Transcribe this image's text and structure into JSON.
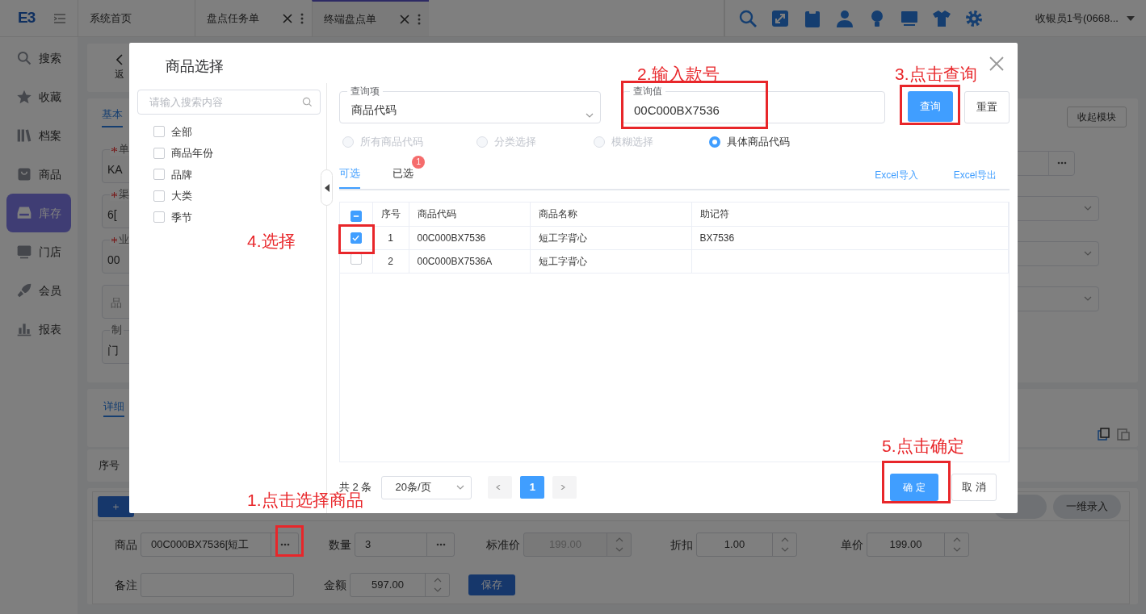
{
  "header": {
    "logo": "E3",
    "tabs": [
      {
        "label": "系统首页",
        "selected": false,
        "closable": false
      },
      {
        "label": "盘点任务单",
        "selected": false,
        "closable": true
      },
      {
        "label": "终端盘点单",
        "selected": true,
        "closable": true
      }
    ],
    "user": "收银员1号(0668..."
  },
  "sidebar": {
    "items": [
      {
        "label": "搜索",
        "selected": false
      },
      {
        "label": "收藏",
        "selected": false
      },
      {
        "label": "档案",
        "selected": false
      },
      {
        "label": "商品",
        "selected": false
      },
      {
        "label": "库存",
        "selected": true
      },
      {
        "label": "门店",
        "selected": false
      },
      {
        "label": "会员",
        "selected": false
      },
      {
        "label": "报表",
        "selected": false
      }
    ]
  },
  "page": {
    "back": "返",
    "base_tab": "基本",
    "collapse_button": "收起模块",
    "fields_left": [
      {
        "label": "单",
        "required": true,
        "value": "KA"
      },
      {
        "label": "渠",
        "required": true,
        "value": "6["
      },
      {
        "label": "业",
        "required": true,
        "value": "00"
      },
      {
        "placeholder": "品"
      },
      {
        "label": "制",
        "required": false,
        "value": "门"
      }
    ],
    "fields_right": [
      {
        "kind": "lookup"
      },
      {
        "kind": "select"
      },
      {
        "kind": "select"
      },
      {
        "kind": "select"
      }
    ],
    "detail_tab": "详细",
    "detail_column": "序号",
    "add_button": "＋",
    "right_button": "一维录入",
    "form_rows": [
      [
        {
          "kind": "lookup",
          "label": "商品",
          "value": "00C000BX7536[短工",
          "disabled": false
        },
        {
          "kind": "lookup",
          "label": "数量",
          "value": "3",
          "disabled": false
        },
        {
          "kind": "spin",
          "label": "标准价",
          "value": "199.00",
          "disabled": true
        },
        {
          "kind": "spin",
          "label": "折扣",
          "value": "1.00",
          "disabled": false
        },
        {
          "kind": "spin",
          "label": "单价",
          "value": "199.00",
          "disabled": false
        }
      ],
      [
        {
          "kind": "text",
          "label": "备注"
        },
        {
          "kind": "spin",
          "label": "金额",
          "value": "597.00",
          "disabled": false
        },
        {
          "kind": "button",
          "label": "保存"
        }
      ]
    ]
  },
  "dialog": {
    "title": "商品选择",
    "search": {
      "placeholder": "请输入搜索内容"
    },
    "tree": [
      {
        "label": "全部",
        "checked": false
      },
      {
        "label": "商品年份",
        "checked": false
      },
      {
        "label": "品牌",
        "checked": false
      },
      {
        "label": "大类",
        "checked": false
      },
      {
        "label": "季节",
        "checked": false
      }
    ],
    "query_item": {
      "label": "查询项",
      "value": "商品代码"
    },
    "query_value": {
      "label": "查询值",
      "value": "00C000BX7536"
    },
    "search_button": "查询",
    "reset_button": "重置",
    "modes": [
      {
        "label": "所有商品代码",
        "selected": false,
        "disabled": true
      },
      {
        "label": "分类选择",
        "selected": false,
        "disabled": true
      },
      {
        "label": "模糊选择",
        "selected": false,
        "disabled": true
      },
      {
        "label": "具体商品代码",
        "selected": true,
        "disabled": false
      }
    ],
    "tabs": [
      {
        "label": "可选",
        "selected": true
      },
      {
        "label": "已选",
        "selected": false,
        "badge": "1"
      }
    ],
    "links": [
      "Excel导入",
      "Excel导出"
    ],
    "table": {
      "select_all": {
        "indeterminate": true
      },
      "columns": [
        "序号",
        "商品代码",
        "商品名称",
        "助记符"
      ],
      "rows": [
        {
          "checked": true,
          "cells": [
            "1",
            "00C000BX7536",
            "短工字背心",
            "BX7536"
          ]
        },
        {
          "checked": false,
          "cells": [
            "2",
            "00C000BX7536A",
            "短工字背心"
          ]
        }
      ]
    },
    "pagination": {
      "total": "共 2 条",
      "page_size": "20条/页",
      "pages": [
        {
          "label": "1",
          "selected": true
        }
      ]
    },
    "ok_button": "确 定",
    "cancel_button": "取 消"
  },
  "annotations": [
    {
      "text": "1.点击选择商品"
    },
    {
      "text": "2.输入款号"
    },
    {
      "text": "3.点击查询"
    },
    {
      "text": "4.选择"
    },
    {
      "text": "5.点击确定"
    }
  ]
}
